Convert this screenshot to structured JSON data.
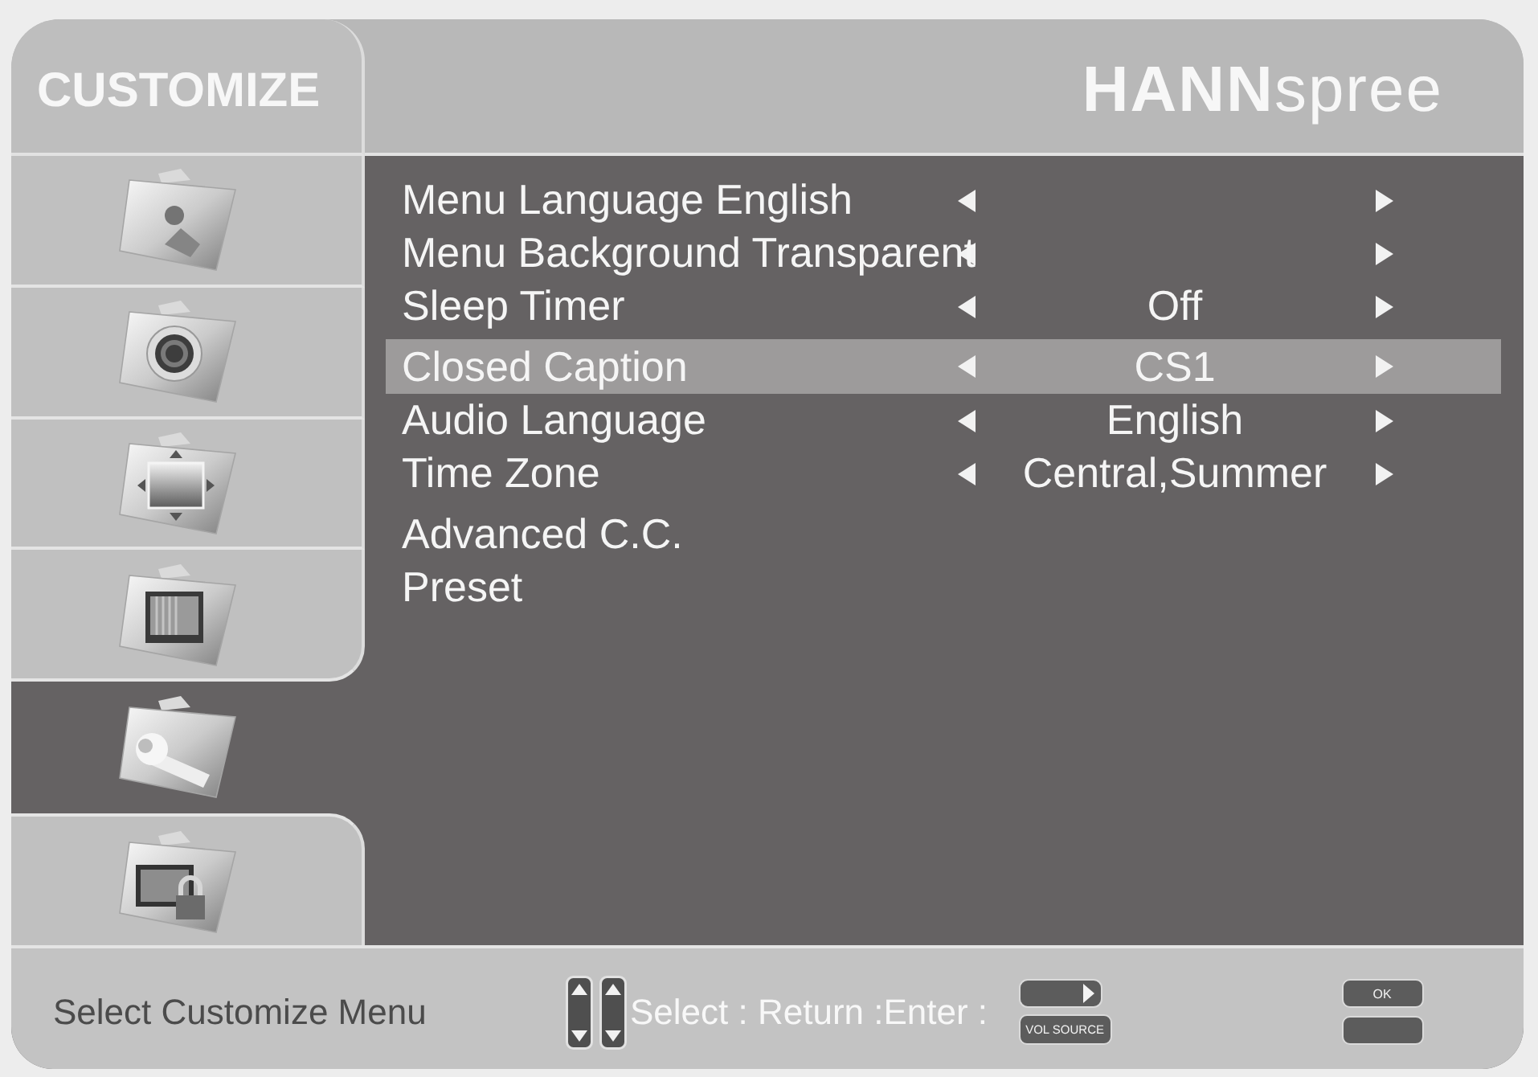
{
  "header": {
    "title": "CUSTOMIZE",
    "logo": "**HANN**spree"
  },
  "sidebar": {
    "items": [
      {
        "kind": "person",
        "selected": false
      },
      {
        "kind": "speaker",
        "selected": false
      },
      {
        "kind": "position",
        "selected": false
      },
      {
        "kind": "monitor",
        "selected": false
      },
      {
        "kind": "wrench",
        "selected": true
      },
      {
        "kind": "lock",
        "selected": false
      }
    ]
  },
  "menu": {
    "items": [
      {
        "kind": "option",
        "label": "Menu Language English",
        "selected": false
      },
      {
        "kind": "option",
        "label": "Menu Background Transparent",
        "selected": false
      },
      {
        "kind": "option",
        "label": "Sleep Timer",
        "value": "Off",
        "selected": false
      },
      {
        "kind": "option",
        "label": "Closed Caption",
        "value": "CS1",
        "selected": true
      },
      {
        "kind": "option",
        "label": "Audio Language",
        "value": "English",
        "selected": false
      },
      {
        "kind": "option",
        "label": "Time Zone",
        "value": "Central,Summer",
        "selected": false
      },
      {
        "kind": "submenu",
        "label": "Advanced C.C.",
        "selected": false
      },
      {
        "kind": "submenu",
        "label": "Preset",
        "selected": false
      }
    ]
  },
  "status_bar": {
    "message": "Select Customize Menu",
    "key_hint": "Select : Return :Enter :",
    "vol_source_label": "VOL SOURCE",
    "ok_label": "OK"
  }
}
